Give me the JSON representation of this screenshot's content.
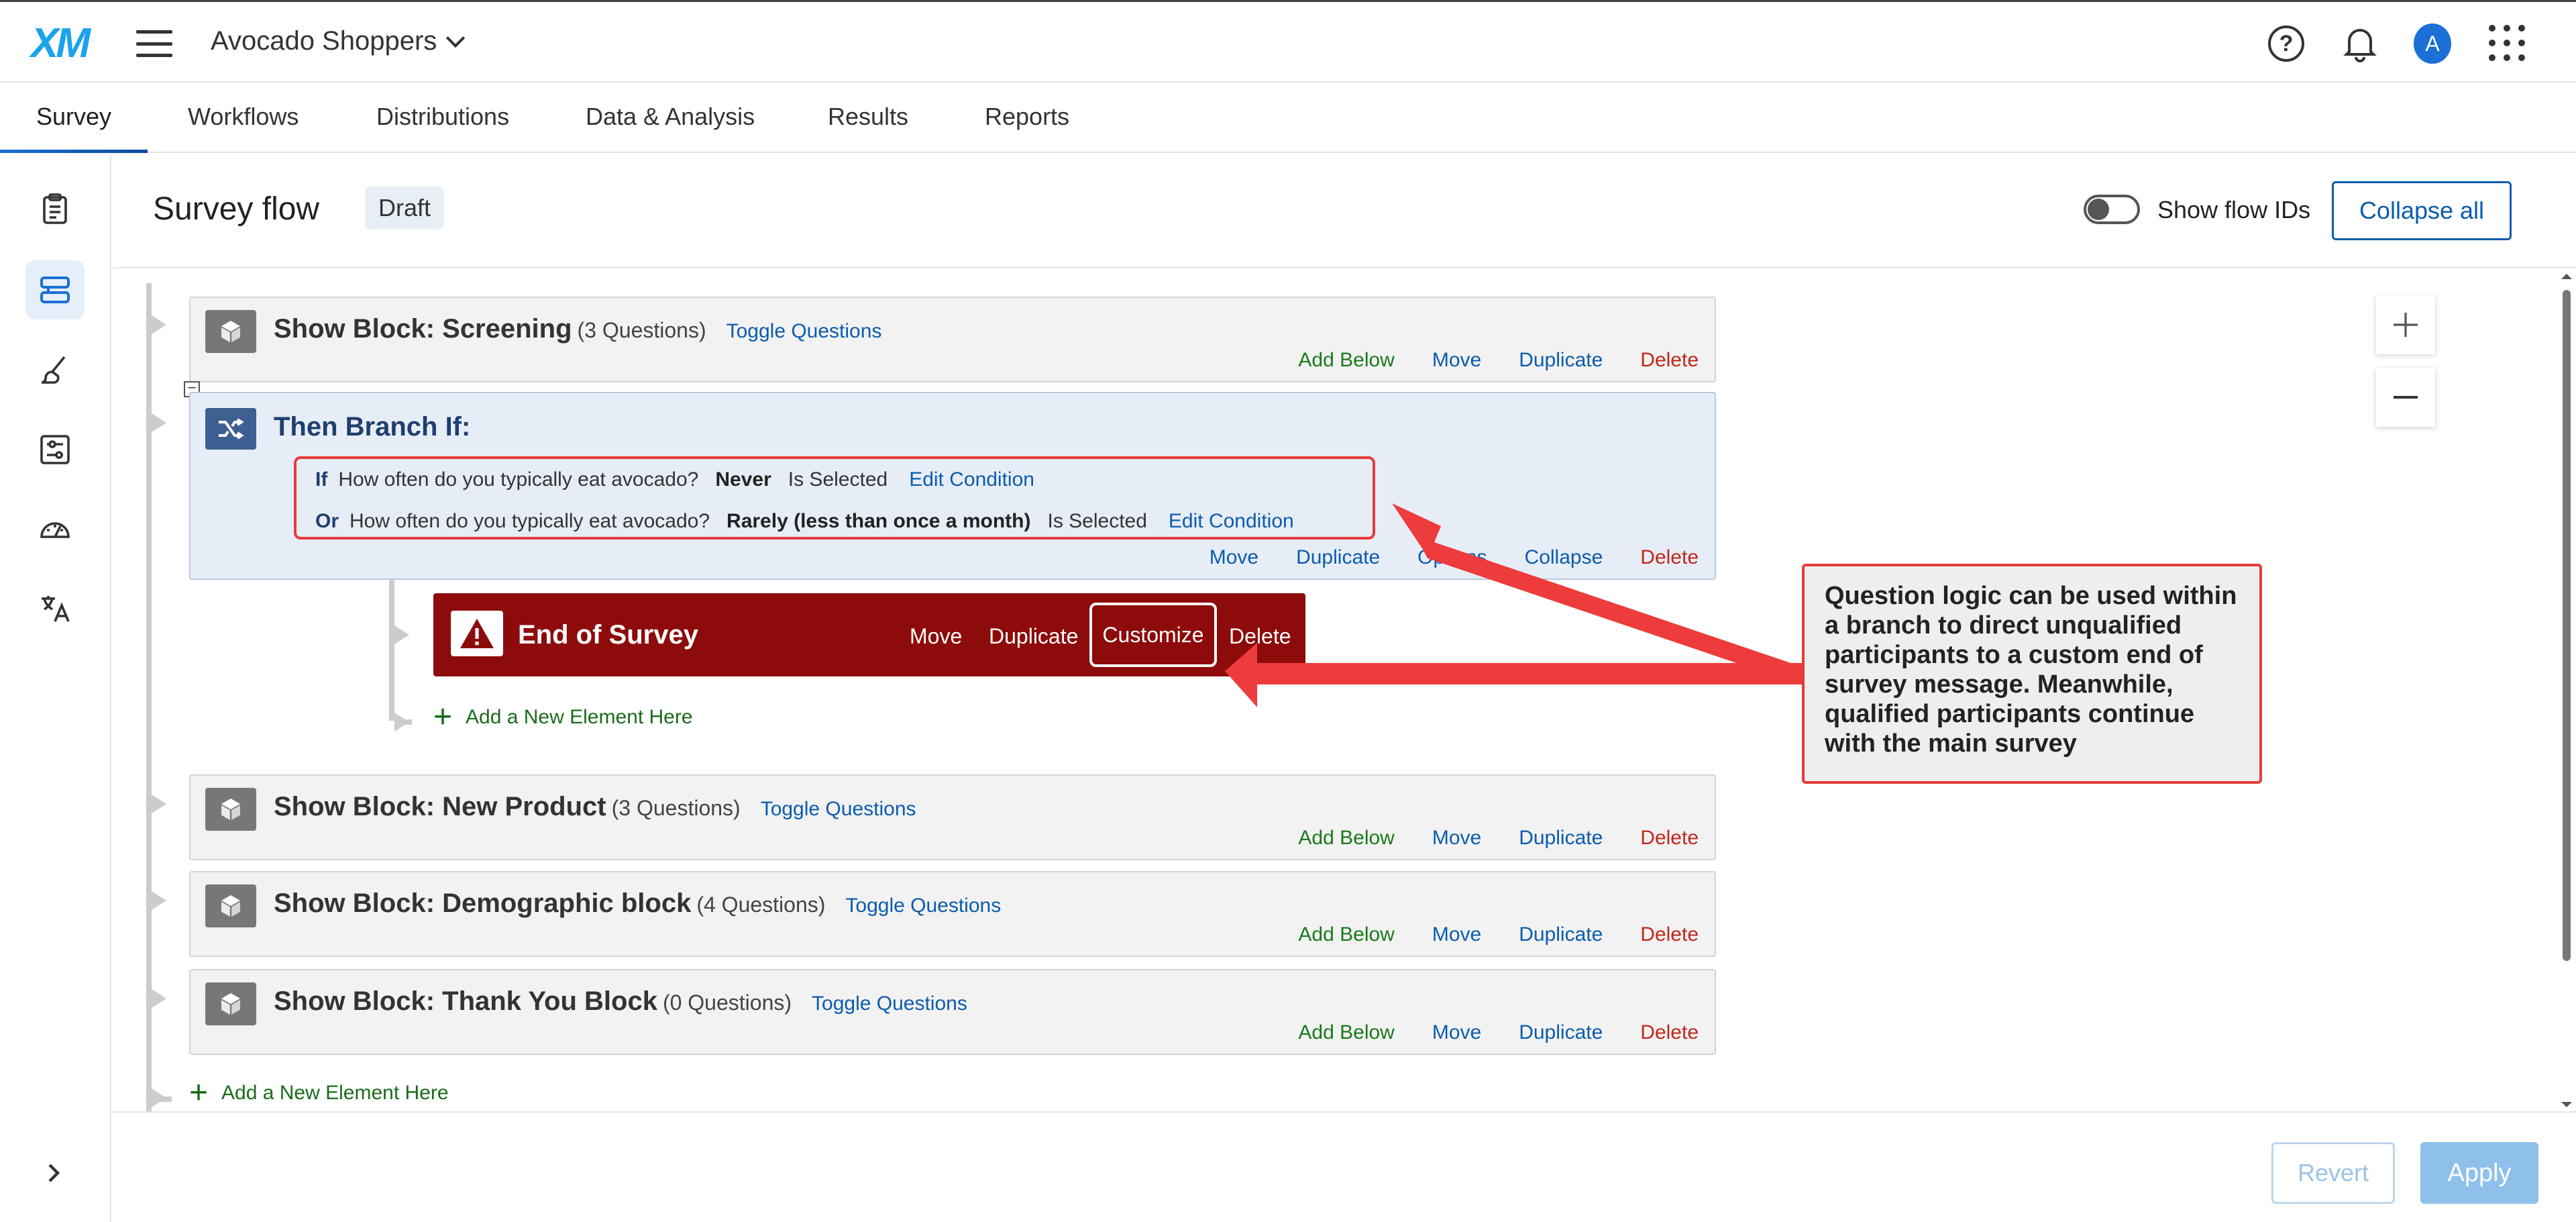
{
  "topbar": {
    "logo": "XM",
    "project_name": "Avocado Shoppers",
    "avatar_initial": "A",
    "help_glyph": "?"
  },
  "tabs": [
    {
      "label": "Survey",
      "active": true
    },
    {
      "label": "Workflows"
    },
    {
      "label": "Distributions"
    },
    {
      "label": "Data & Analysis"
    },
    {
      "label": "Results"
    },
    {
      "label": "Reports"
    }
  ],
  "rail": {
    "items": [
      "clipboard-icon",
      "survey-flow-icon",
      "paintbrush-icon",
      "options-icon",
      "gauge-icon",
      "translate-icon"
    ],
    "active": "survey-flow-icon"
  },
  "header": {
    "title": "Survey flow",
    "status": "Draft",
    "toggle_label": "Show flow IDs",
    "toggle_on": false,
    "collapse_all": "Collapse all"
  },
  "actions": {
    "add_below": "Add Below",
    "move": "Move",
    "duplicate": "Duplicate",
    "delete": "Delete",
    "options": "Options",
    "collapse": "Collapse",
    "customize": "Customize",
    "toggle_questions": "Toggle Questions",
    "add_element": "Add a New Element Here",
    "edit_condition": "Edit Condition"
  },
  "blocks": [
    {
      "title": "Show Block: Screening",
      "count": "(3 Questions)"
    },
    {
      "title": "Show Block: New Product",
      "count": "(3 Questions)"
    },
    {
      "title": "Show Block: Demographic block",
      "count": "(4 Questions)"
    },
    {
      "title": "Show Block: Thank You Block",
      "count": "(0 Questions)"
    }
  ],
  "branch": {
    "title": "Then Branch If:",
    "collapse_glyph": "−",
    "conditions": [
      {
        "keyword": "If",
        "question": "How often do you typically eat avocado?",
        "answer": "Never",
        "operator": "Is Selected"
      },
      {
        "keyword": "Or",
        "question": "How often do you typically eat avocado?",
        "answer": "Rarely (less than once a month)",
        "operator": "Is Selected"
      }
    ]
  },
  "end_of_survey": {
    "title": "End of Survey"
  },
  "callout": {
    "text": "Question logic can be used within a branch to direct unqualified participants to a custom end of survey message. Meanwhile, qualified participants continue with the main survey",
    "border_color": "#e83a3a"
  },
  "footer": {
    "revert": "Revert",
    "apply": "Apply"
  },
  "colors": {
    "accent": "#0b5cad",
    "logo": "#1aa3ea",
    "end_of_survey": "#8d0b0b",
    "add_green": "#1a7a1a",
    "delete_red": "#c0281a",
    "annotation_red": "#e83a3a"
  }
}
